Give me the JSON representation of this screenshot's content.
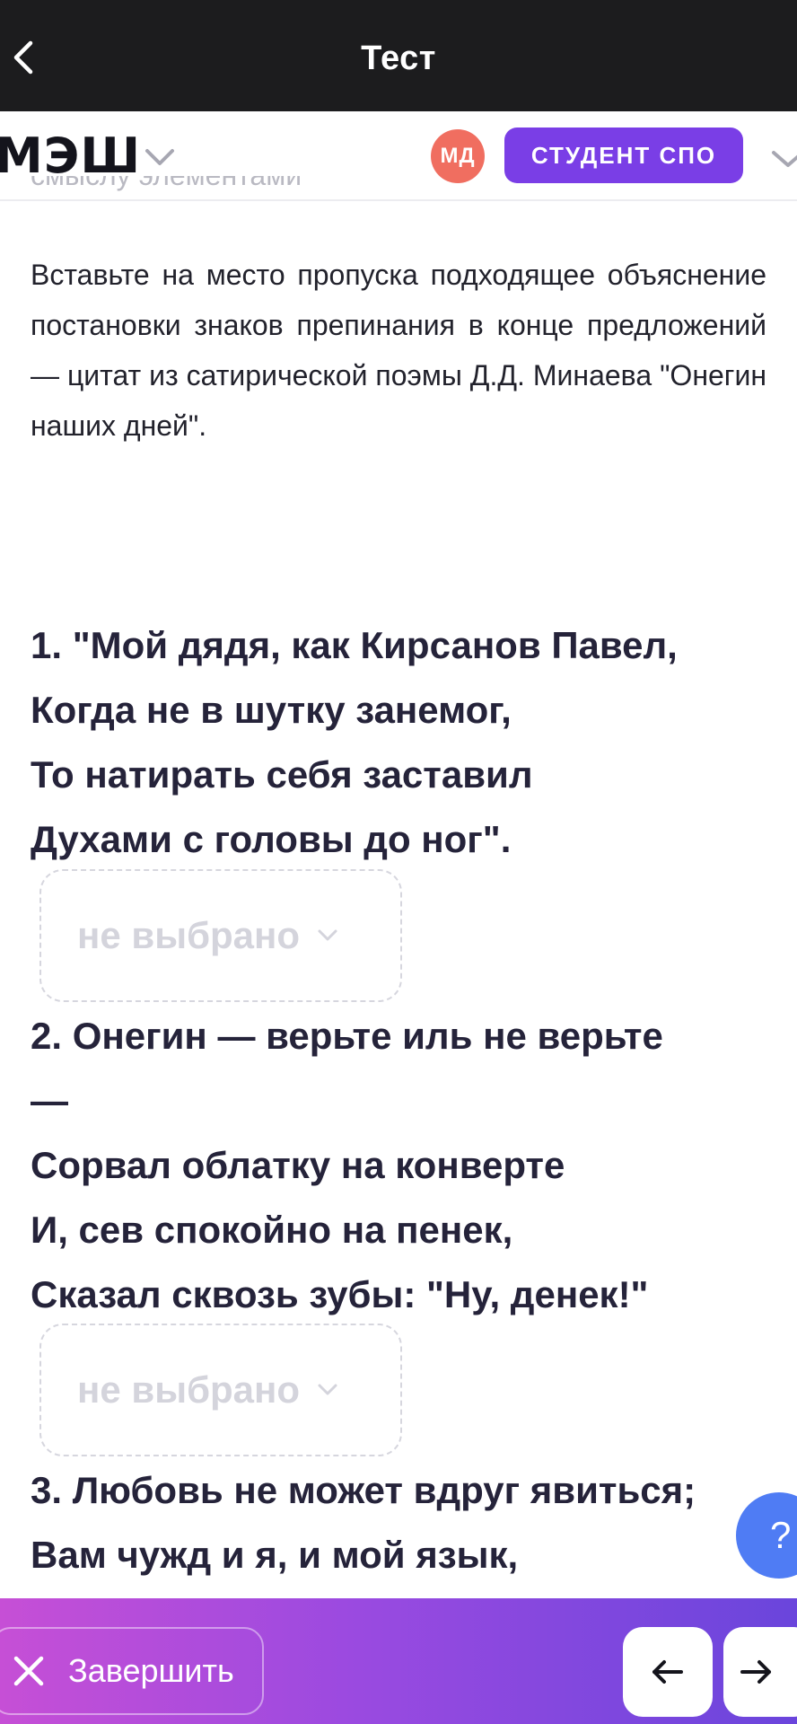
{
  "titlebar": {
    "title": "Тест"
  },
  "header": {
    "logo": "МЭШ",
    "avatar_initials": "МД",
    "role": "СТУДЕНТ СПО"
  },
  "content": {
    "faded_line": "смыслу элементами",
    "instruction": "Вставьте на место пропуска подходящее объяснение постановки знаков препинания в конце предложений — цитат из сатирической поэмы Д.Д. Минаева \"Онегин наших дней\".",
    "questions": [
      {
        "lines": [
          "1. \"Мой дядя, как Кирсанов Павел,",
          "Когда не в шутку занемог,",
          "То натирать себя заставил",
          "Духами с головы до ног\"."
        ],
        "answer": "не выбрано"
      },
      {
        "lines": [
          "2. Онегин — верьте иль не верьте",
          "—",
          "Сорвал облатку на конверте",
          "И, сев спокойно на пенек,",
          "Сказал сквозь зубы: \"Ну, денек!\""
        ],
        "answer": "не выбрано"
      },
      {
        "lines": [
          "3. Любовь не может вдруг явиться;",
          "Вам чужд и я, и мой язык,"
        ]
      }
    ]
  },
  "help": {
    "label": "?"
  },
  "bottombar": {
    "finish_label": "Завершить"
  },
  "colors": {
    "titlebar_bg": "#1c1c1e",
    "accent": "#7a3ee6",
    "avatar": "#f06e60",
    "help": "#4f7cf4",
    "text": "#25233a"
  },
  "icons": {
    "back": "chevron-left-icon",
    "logo_menu": "chevron-down-icon",
    "dropdown": "chevron-down-icon",
    "finish": "close-icon",
    "prev": "arrow-left-icon",
    "next": "arrow-right-icon"
  }
}
